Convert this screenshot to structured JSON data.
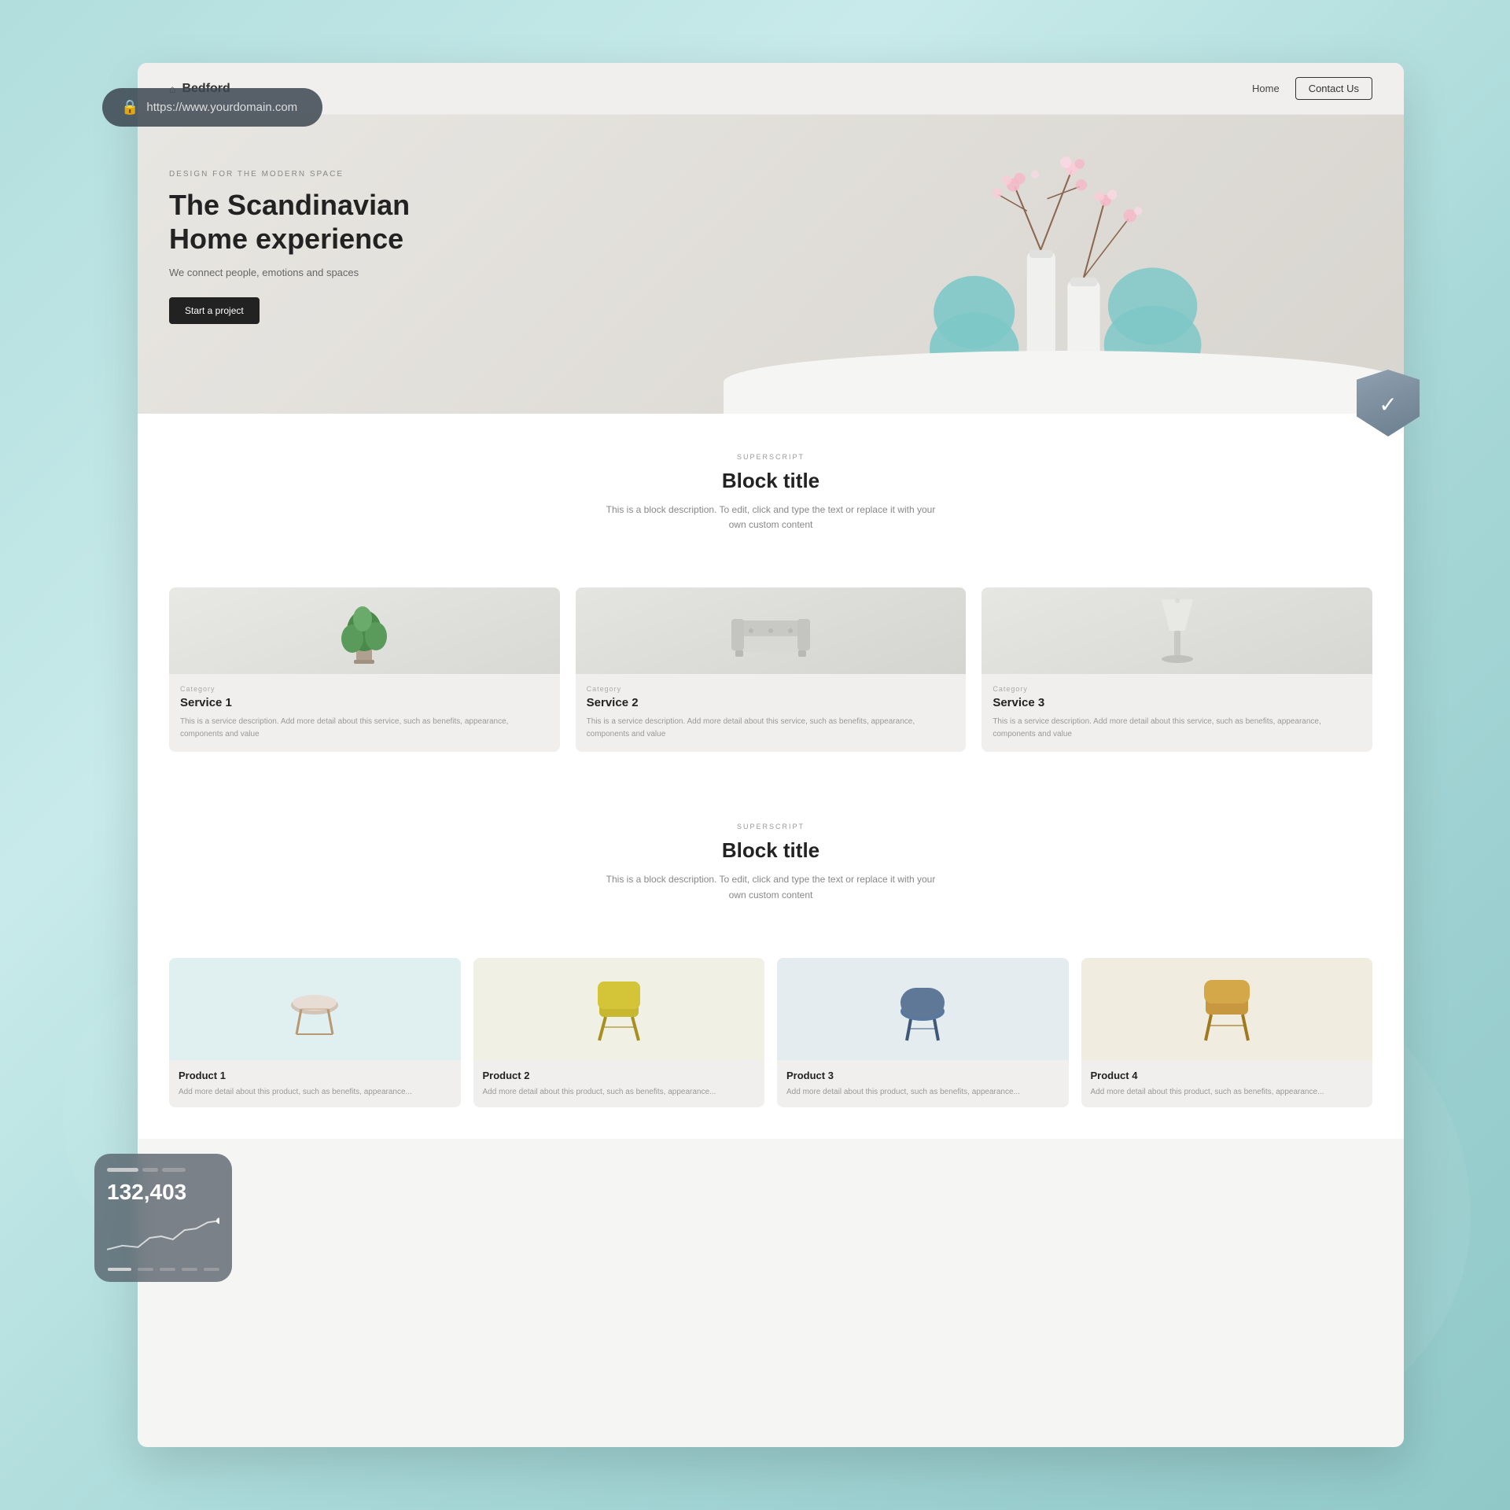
{
  "background": {
    "gradient_start": "#b2dede",
    "gradient_end": "#90c8c8"
  },
  "url_bar": {
    "url": "https://www.yourdomain.com",
    "lock_icon": "🔒"
  },
  "nav": {
    "logo": "Bedford",
    "logo_icon": "⌂",
    "links": [
      {
        "label": "Home",
        "active": true
      },
      {
        "label": "Contact Us",
        "active": false,
        "is_button": true
      }
    ]
  },
  "hero": {
    "superscript": "DESIGN FOR THE MODERN SPACE",
    "title": "The Scandinavian Home experience",
    "subtitle": "We connect people, emotions and spaces",
    "cta_label": "Start a project"
  },
  "section1": {
    "superscript": "SUPERSCRIPT",
    "title": "Block title",
    "description": "This is a block description. To edit, click and type the text or replace it with your own custom content",
    "services": [
      {
        "category": "Category",
        "name": "Service 1",
        "description": "This is a service description. Add more detail about this service, such as benefits, appearance, components and value",
        "image_type": "plant"
      },
      {
        "category": "Category",
        "name": "Service 2",
        "description": "This is a service description. Add more detail about this service, such as benefits, appearance, components and value",
        "image_type": "sofa"
      },
      {
        "category": "Category",
        "name": "Service 3",
        "description": "This is a service description. Add more detail about this service, such as benefits, appearance, components and value",
        "image_type": "lamp"
      }
    ]
  },
  "section2": {
    "superscript": "SUPERSCRIPT",
    "title": "Block title",
    "description": "This is a block description. To edit, click and type the text or replace it with your own custom content",
    "products": [
      {
        "name": "Product 1",
        "description": "Add more detail about this product, such as benefits, appearance...",
        "color": "#d4c4b8",
        "image_type": "stool"
      },
      {
        "name": "Product 2",
        "description": "Add more detail about this product, such as benefits, appearance...",
        "color": "#b8b840",
        "image_type": "chair_yellow"
      },
      {
        "name": "Product 3",
        "description": "Add more detail about this product, such as benefits, appearance...",
        "color": "#6080a0",
        "image_type": "chair_blue"
      },
      {
        "name": "Product 4",
        "description": "Add more detail about this product, such as benefits, appearance...",
        "color": "#c09040",
        "image_type": "chair_tan"
      }
    ]
  },
  "stats_widget": {
    "number": "132,403"
  },
  "security_badge": {
    "check_icon": "✓"
  }
}
